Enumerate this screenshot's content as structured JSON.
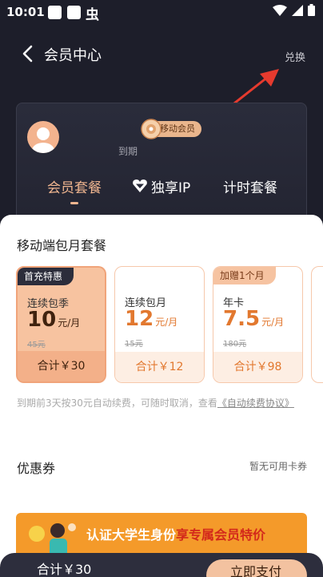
{
  "status": {
    "time": "10:01",
    "glyph": "虫"
  },
  "header": {
    "title": "会员中心",
    "redeem": "兑换"
  },
  "member": {
    "badge": "移动会员",
    "expire": "到期",
    "tabs": [
      {
        "label": "会员套餐",
        "active": true
      },
      {
        "label": "独享IP",
        "active": false
      },
      {
        "label": "计时套餐",
        "active": false
      }
    ]
  },
  "package": {
    "title": "移动端包月套餐",
    "plans": [
      {
        "tag": "首充特惠",
        "name": "连续包季",
        "price": "10",
        "unit": "元/月",
        "original": "45元",
        "total": "合计￥30",
        "selected": true
      },
      {
        "tag": "",
        "name": "连续包月",
        "price": "12",
        "unit": "元/月",
        "original": "15元",
        "total": "合计￥12",
        "selected": false
      },
      {
        "tag": "加赠1个月",
        "name": "年卡",
        "price": "7.5",
        "unit": "元/月",
        "original": "180元",
        "total": "合计￥98",
        "selected": false
      }
    ],
    "notice": "到期前3天按30元自动续费，可随时取消，查看",
    "notice_link": "《自动续费协议》"
  },
  "coupon": {
    "label": "优惠券",
    "status": "暂无可用卡券"
  },
  "banner": {
    "text": "认证大学生身份",
    "highlight": "享专属会员特价"
  },
  "paybar": {
    "total": "合计￥30",
    "button": "立即支付"
  },
  "colors": {
    "accent": "#f1b690",
    "dark": "#1d1e2a",
    "price": "#e2782f"
  }
}
